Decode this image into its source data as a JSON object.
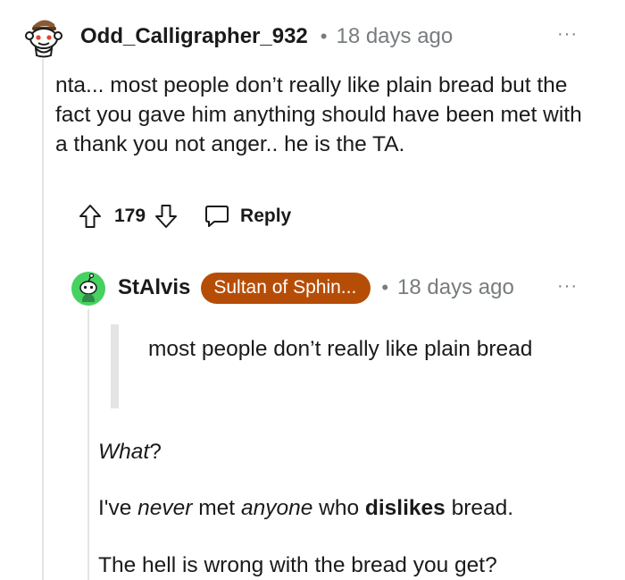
{
  "comments": [
    {
      "username": "Odd_Calligrapher_932",
      "separator": "•",
      "timestamp": "18 days ago",
      "more_label": "···",
      "avatar_icon": "snoo-avatar-icon",
      "body": "nta... most people don’t really like plain bread but the fact you gave him anything should have been met with a thank you not anger.. he is the TA.",
      "vote_count": "179",
      "reply_label": "Reply"
    },
    {
      "username": "StAlvis",
      "flair": "Sultan of Sphin...",
      "flair_color": "#b64d07",
      "separator": "•",
      "timestamp": "18 days ago",
      "more_label": "···",
      "avatar_icon": "snoo-green-avatar-icon",
      "quote": "most people don’t really like plain bread",
      "paragraphs": {
        "p1_em": "What",
        "p1_rest": "?",
        "p2_a": "I've ",
        "p2_em1": "never",
        "p2_b": " met ",
        "p2_em2": "anyone",
        "p2_c": " who ",
        "p2_strong": "dislikes",
        "p2_d": " bread.",
        "p3": "The hell is wrong with the bread you get?"
      }
    }
  ],
  "colors": {
    "text": "#1a1a1b",
    "meta": "#787c7e",
    "thread_line": "#e4e4e4"
  }
}
